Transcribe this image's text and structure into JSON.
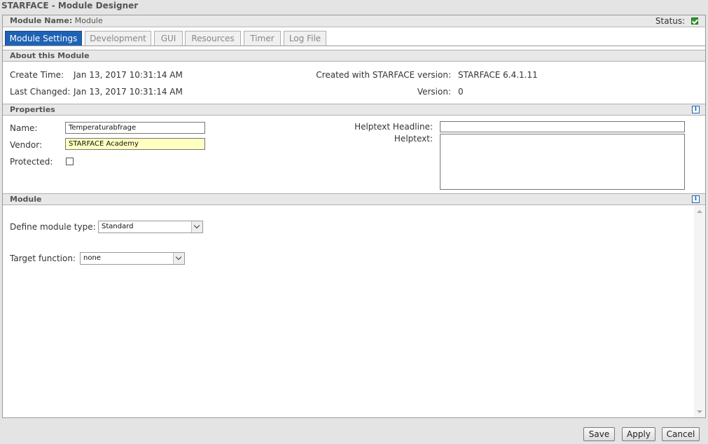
{
  "window": {
    "title": "STARFACE - Module Designer"
  },
  "header": {
    "module_name_label": "Module Name:",
    "module_name_value": "Module",
    "status_label": "Status:"
  },
  "tabs": [
    {
      "label": "Module Settings",
      "active": true
    },
    {
      "label": "Development"
    },
    {
      "label": "GUI"
    },
    {
      "label": "Resources"
    },
    {
      "label": "Timer"
    },
    {
      "label": "Log File"
    }
  ],
  "about": {
    "title": "About this Module",
    "create_time_label": "Create Time:",
    "create_time_value": "Jan 13, 2017 10:31:14 AM",
    "last_changed_label": "Last Changed:",
    "last_changed_value": "Jan 13, 2017 10:31:14 AM",
    "created_with_label": "Created with STARFACE version:",
    "created_with_value": "STARFACE 6.4.1.11",
    "version_label": "Version:",
    "version_value": "0"
  },
  "properties": {
    "title": "Properties",
    "name_label": "Name:",
    "name_value": "Temperaturabfrage",
    "vendor_label": "Vendor:",
    "vendor_value": "STARFACE Academy",
    "protected_label": "Protected:",
    "protected_checked": false,
    "helptext_headline_label": "Helptext Headline:",
    "helptext_headline_value": "",
    "helptext_label": "Helptext:",
    "helptext_value": ""
  },
  "module": {
    "title": "Module",
    "define_type_label": "Define module type:",
    "define_type_value": "Standard",
    "target_function_label": "Target function:",
    "target_function_value": "none"
  },
  "buttons": {
    "save": "Save",
    "apply": "Apply",
    "cancel": "Cancel"
  },
  "icons": {
    "status": "status-ok-check-icon",
    "info": "info-icon"
  },
  "colors": {
    "active_tab": "#1e62b4",
    "status_ok": "#2a9a2a",
    "vendor_field_bg": "#ffffc0"
  }
}
